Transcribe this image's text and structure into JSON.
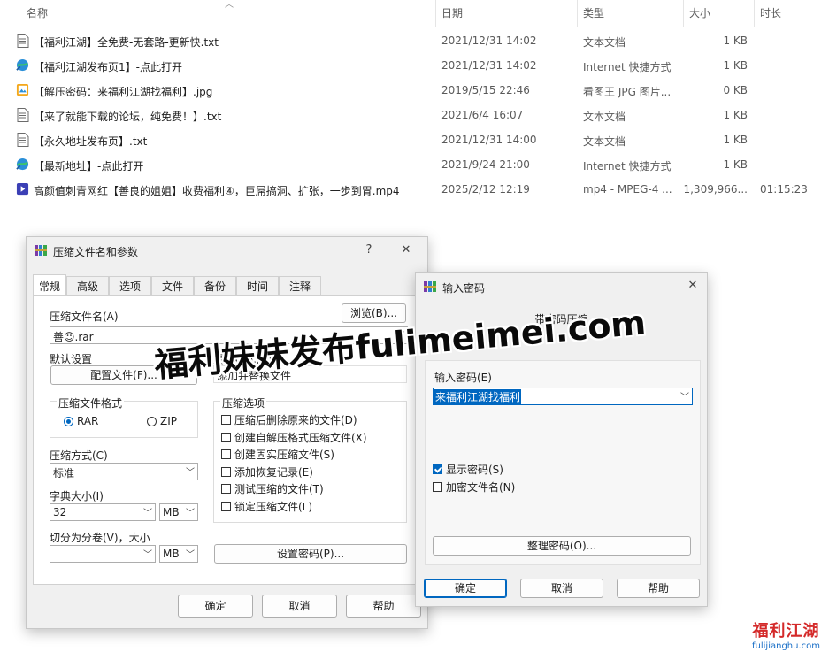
{
  "explorer": {
    "columns": {
      "name": "名称",
      "date": "日期",
      "type": "类型",
      "size": "大小",
      "duration": "时长"
    },
    "files": [
      {
        "icon": "text-file-icon",
        "name": "【福利江湖】全免费-无套路-更新快.txt",
        "date": "2021/12/31 14:02",
        "type": "文本文档",
        "size": "1 KB",
        "duration": ""
      },
      {
        "icon": "internet-shortcut-icon",
        "name": "【福利江湖发布页1】-点此打开",
        "date": "2021/12/31 14:02",
        "type": "Internet 快捷方式",
        "size": "1 KB",
        "duration": ""
      },
      {
        "icon": "image-file-icon",
        "name": "【解压密码：来福利江湖找福利】.jpg",
        "date": "2019/5/15 22:46",
        "type": "看图王 JPG 图片...",
        "size": "0 KB",
        "duration": ""
      },
      {
        "icon": "text-file-icon",
        "name": "【来了就能下载的论坛，纯免费！】.txt",
        "date": "2021/6/4 16:07",
        "type": "文本文档",
        "size": "1 KB",
        "duration": ""
      },
      {
        "icon": "text-file-icon",
        "name": "【永久地址发布页】.txt",
        "date": "2021/12/31 14:00",
        "type": "文本文档",
        "size": "1 KB",
        "duration": ""
      },
      {
        "icon": "internet-shortcut-icon",
        "name": "【最新地址】-点此打开",
        "date": "2021/9/24 21:00",
        "type": "Internet 快捷方式",
        "size": "1 KB",
        "duration": ""
      },
      {
        "icon": "video-file-icon",
        "name": "高颜值刺青网红【善良的姐姐】收费福利④，巨屌搞洞、扩张，一步到胃.mp4",
        "date": "2025/2/12 12:19",
        "type": "mp4 - MPEG-4 ...",
        "size": "1,309,966...",
        "duration": "01:15:23"
      }
    ]
  },
  "archive_dialog": {
    "title": "压缩文件名和参数",
    "help": "?",
    "close": "✕",
    "tabs": [
      "常规",
      "高级",
      "选项",
      "文件",
      "备份",
      "时间",
      "注释"
    ],
    "archive_name_label": "压缩文件名(A)",
    "browse": "浏览(B)...",
    "archive_name_value": "善☺.rar",
    "default_settings_label": "默认设置",
    "profiles": "配置文件(F)...",
    "update_mode_label": "更新模式(U)",
    "update_mode_value": "添加并替换文件",
    "format_label": "压缩文件格式",
    "format_rar": "RAR",
    "format_zip": "ZIP",
    "options_label": "压缩选项",
    "options": [
      {
        "label": "压缩后删除原来的文件(D)",
        "checked": false
      },
      {
        "label": "创建自解压格式压缩文件(X)",
        "checked": false
      },
      {
        "label": "创建固实压缩文件(S)",
        "checked": false
      },
      {
        "label": "添加恢复记录(E)",
        "checked": false
      },
      {
        "label": "测试压缩的文件(T)",
        "checked": false
      },
      {
        "label": "锁定压缩文件(L)",
        "checked": false
      }
    ],
    "method_label": "压缩方式(C)",
    "method_value": "标准",
    "dict_label": "字典大小(I)",
    "dict_value": "32",
    "dict_unit": "MB",
    "split_label": "切分为分卷(V)，大小",
    "split_value": "",
    "split_unit": "MB",
    "set_password": "设置密码(P)...",
    "ok": "确定",
    "cancel": "取消",
    "help_btn": "帮助"
  },
  "password_dialog": {
    "title": "输入密码",
    "close": "✕",
    "heading": "带密码压缩",
    "enter_label": "输入密码(E)",
    "password_value": "来福利江湖找福利",
    "show_password": "显示密码(S)",
    "show_password_checked": true,
    "encrypt_names": "加密文件名(N)",
    "encrypt_names_checked": false,
    "organize": "整理密码(O)...",
    "ok": "确定",
    "cancel": "取消",
    "help_btn": "帮助"
  },
  "watermark": {
    "text": "福利妹妹发布fulimeimei.com",
    "logo_line1": "福利江湖",
    "logo_line2": "fulijianghu.com"
  }
}
